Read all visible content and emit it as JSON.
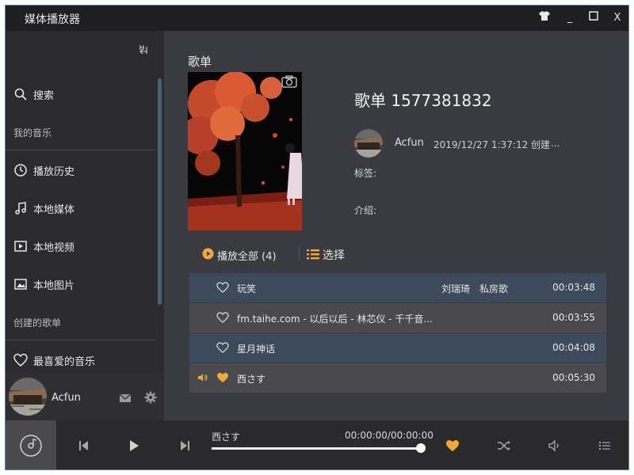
{
  "window": {
    "title": "媒体播放器"
  },
  "titlebar": {
    "skin_icon": "shirt-icon",
    "minimize": "_",
    "maximize": "☐",
    "close": "X"
  },
  "sidebar": {
    "collapse_icon": "collapse-icon",
    "search_label": "搜索",
    "my_music_label": "我的音乐",
    "items": [
      {
        "label": "播放历史",
        "icon": "history-icon"
      },
      {
        "label": "本地媒体",
        "icon": "music-note-icon"
      },
      {
        "label": "本地视频",
        "icon": "video-icon"
      },
      {
        "label": "本地图片",
        "icon": "image-icon"
      }
    ],
    "created_playlists_label": "创建的歌单",
    "favorite_label": "最喜爱的音乐"
  },
  "user": {
    "name": "Acfun",
    "mail_icon": "mail-icon",
    "settings_icon": "gear-icon"
  },
  "playlist": {
    "section_title": "歌单",
    "title": "歌单 1577381832",
    "creator": "Acfun",
    "created_at": "2019/12/27 1:37:12 创建",
    "more": "...",
    "tags_label": "标签:",
    "intro_label": "介绍:",
    "play_all_label": "播放全部 (4)",
    "select_label": "选择"
  },
  "tracks": [
    {
      "name": "玩笑",
      "artist": "刘瑞琦",
      "album": "私房歌",
      "duration": "00:03:48",
      "liked": false,
      "playing": false
    },
    {
      "name": "fm.taihe.com - 以后以后 - 林芯仪 - 千千音...",
      "artist": "",
      "album": "",
      "duration": "00:03:55",
      "liked": false,
      "playing": false
    },
    {
      "name": "星月神话",
      "artist": "",
      "album": "",
      "duration": "00:04:08",
      "liked": false,
      "playing": false
    },
    {
      "name": "西さす",
      "artist": "",
      "album": "",
      "duration": "00:05:30",
      "liked": true,
      "playing": true
    }
  ],
  "player": {
    "now_playing": "西さす",
    "time": "00:00:00/00:00:00",
    "progress": 1.0,
    "liked": true
  },
  "colors": {
    "accent": "#f2a93b",
    "row_blue": "#3d4a5c",
    "row_gray": "#4a4a4e"
  }
}
